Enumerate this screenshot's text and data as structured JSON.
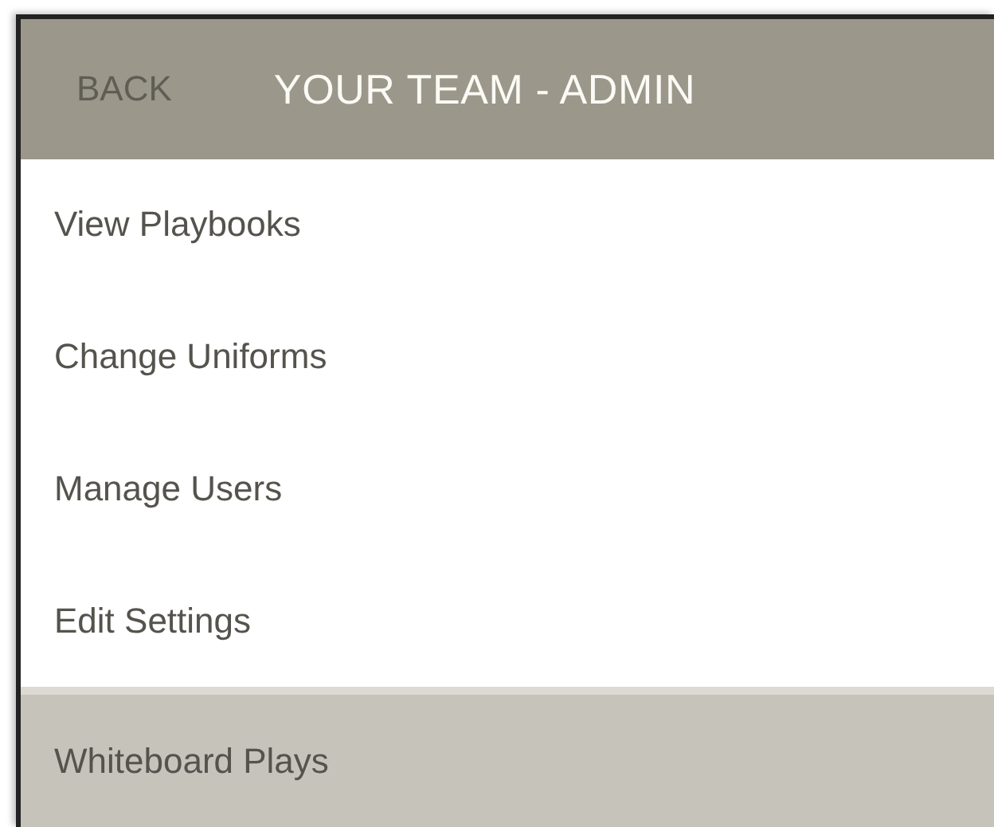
{
  "header": {
    "back": "BACK",
    "title": "YOUR TEAM - ADMIN"
  },
  "menu": [
    {
      "label": "View Playbooks",
      "selected": false
    },
    {
      "label": "Change Uniforms",
      "selected": false
    },
    {
      "label": "Manage Users",
      "selected": false
    },
    {
      "label": "Edit Settings",
      "selected": false
    },
    {
      "label": "Whiteboard Plays",
      "selected": true
    }
  ]
}
